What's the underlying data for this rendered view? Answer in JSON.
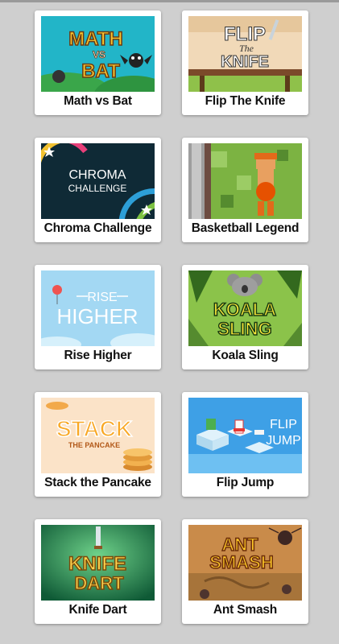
{
  "games": [
    {
      "title": "Math vs Bat",
      "art": "math-vs-bat-artwork",
      "art_text": [
        "MATH",
        "VS",
        "BAT"
      ],
      "bg": "#20b3c6"
    },
    {
      "title": "Flip The Knife",
      "art": "flip-the-knife-artwork",
      "art_text": [
        "FLIP",
        "The",
        "KNIFE"
      ],
      "bg": "#f0d6b4"
    },
    {
      "title": "Chroma Challenge",
      "art": "chroma-challenge-artwork",
      "art_text": [
        "CHROMA",
        "CHALLENGE"
      ],
      "bg": "#0f2a36"
    },
    {
      "title": "Basketball Legend",
      "art": "basketball-legend-artwork",
      "art_text": [],
      "bg": "#7cb342"
    },
    {
      "title": "Rise Higher",
      "art": "rise-higher-artwork",
      "art_text": [
        "RISE",
        "HIGHER"
      ],
      "bg": "#9fd7f2"
    },
    {
      "title": "Koala Sling",
      "art": "koala-sling-artwork",
      "art_text": [
        "KOALA",
        "SLING"
      ],
      "bg": "#8bc34a"
    },
    {
      "title": "Stack the Pancake",
      "art": "stack-the-pancake-artwork",
      "art_text": [
        "STACK",
        "THE PANCAKE"
      ],
      "bg": "#fbe3c8"
    },
    {
      "title": "Flip Jump",
      "art": "flip-jump-artwork",
      "art_text": [
        "FLIP",
        "JUMP"
      ],
      "bg": "#3ea0e6"
    },
    {
      "title": "Knife Dart",
      "art": "knife-dart-artwork",
      "art_text": [
        "KNIFE",
        "DART"
      ],
      "bg": "#1e7a4a"
    },
    {
      "title": "Ant Smash",
      "art": "ant-smash-artwork",
      "art_text": [
        "ANT",
        "SMASH"
      ],
      "bg": "#c98b4a"
    }
  ]
}
